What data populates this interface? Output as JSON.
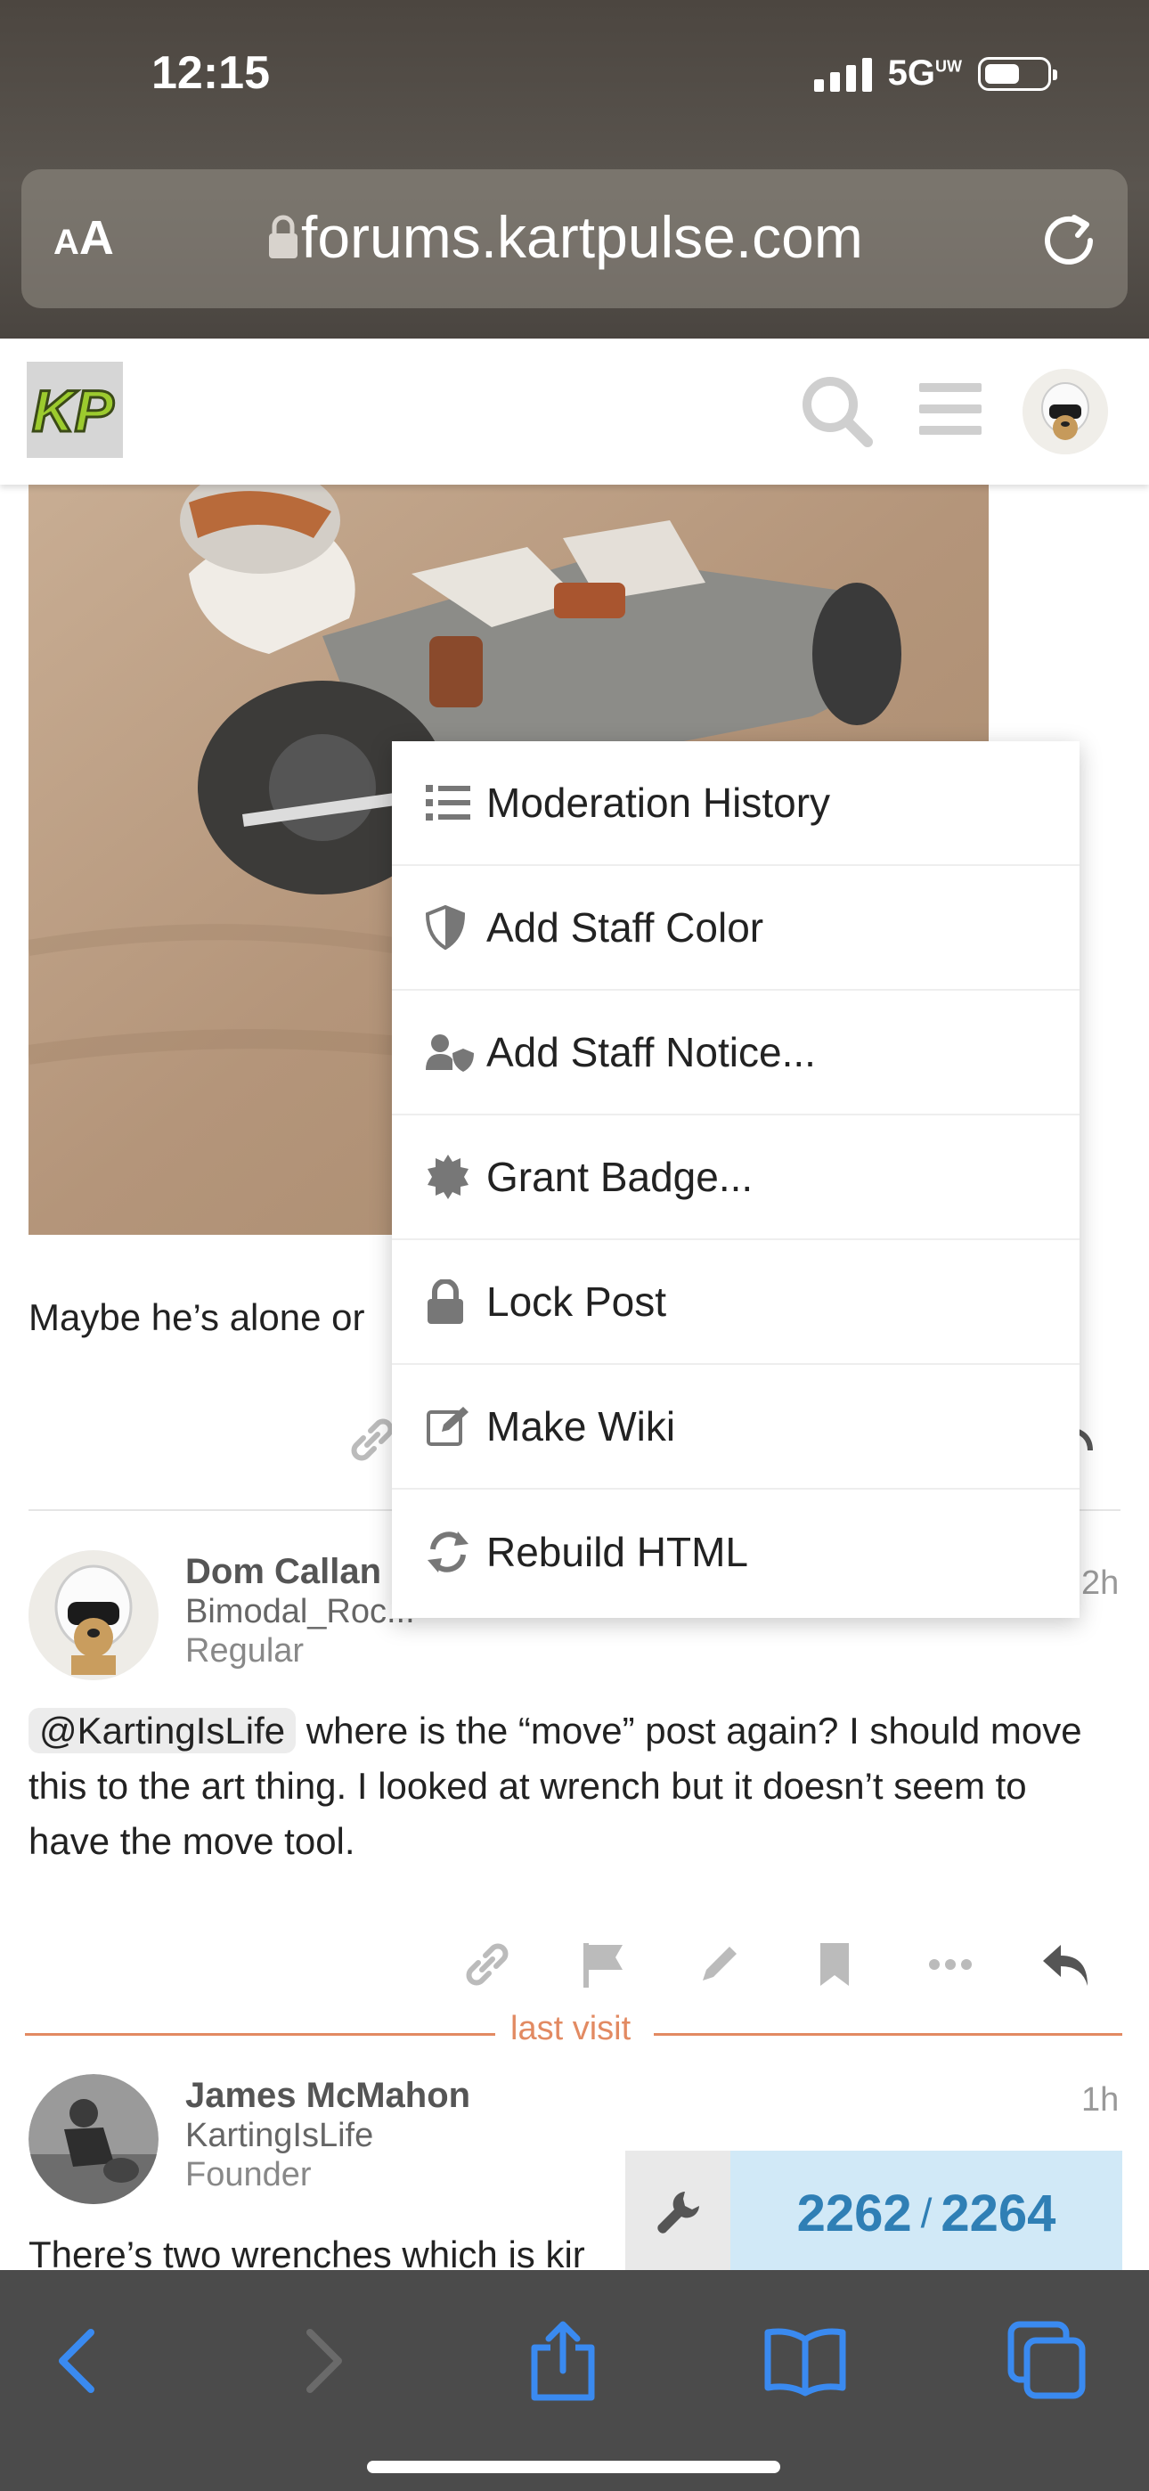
{
  "status_bar": {
    "time": "12:15",
    "network": "5G",
    "network_sup": "UW"
  },
  "browser": {
    "text_size_label_small": "A",
    "text_size_label_large": "A",
    "url": "forums.kartpulse.com"
  },
  "header": {
    "logo_text": "KP"
  },
  "post1": {
    "text": "Maybe he’s alone or"
  },
  "post2": {
    "name": "Dom Callan",
    "username": "Bimodal_Roc...",
    "title": "Regular",
    "time": "2h",
    "mention": "@KartingIsLife",
    "text": " where is the “move” post again? I should move this to the art thing. I looked at wrench but it doesn’t seem to have the move tool."
  },
  "last_visit_label": "last visit",
  "post3": {
    "name": "James McMahon",
    "username": "KartingIsLife",
    "title": "Founder",
    "time": "1h",
    "text": "There’s two wrenches which is kir"
  },
  "menu": {
    "items": [
      {
        "label": "Moderation History",
        "icon": "list-icon"
      },
      {
        "label": "Add Staff Color",
        "icon": "shield-icon"
      },
      {
        "label": "Add Staff Notice...",
        "icon": "user-shield-icon"
      },
      {
        "label": "Grant Badge...",
        "icon": "certificate-icon"
      },
      {
        "label": "Lock Post",
        "icon": "lock-icon"
      },
      {
        "label": "Make Wiki",
        "icon": "edit-icon"
      },
      {
        "label": "Rebuild HTML",
        "icon": "sync-icon"
      }
    ]
  },
  "progress": {
    "current": "2262",
    "separator": "/",
    "total": "2264"
  },
  "colors": {
    "accent_blue": "#2f7fb5",
    "last_visit": "#e28a62",
    "ios_blue": "#3a8af0"
  }
}
